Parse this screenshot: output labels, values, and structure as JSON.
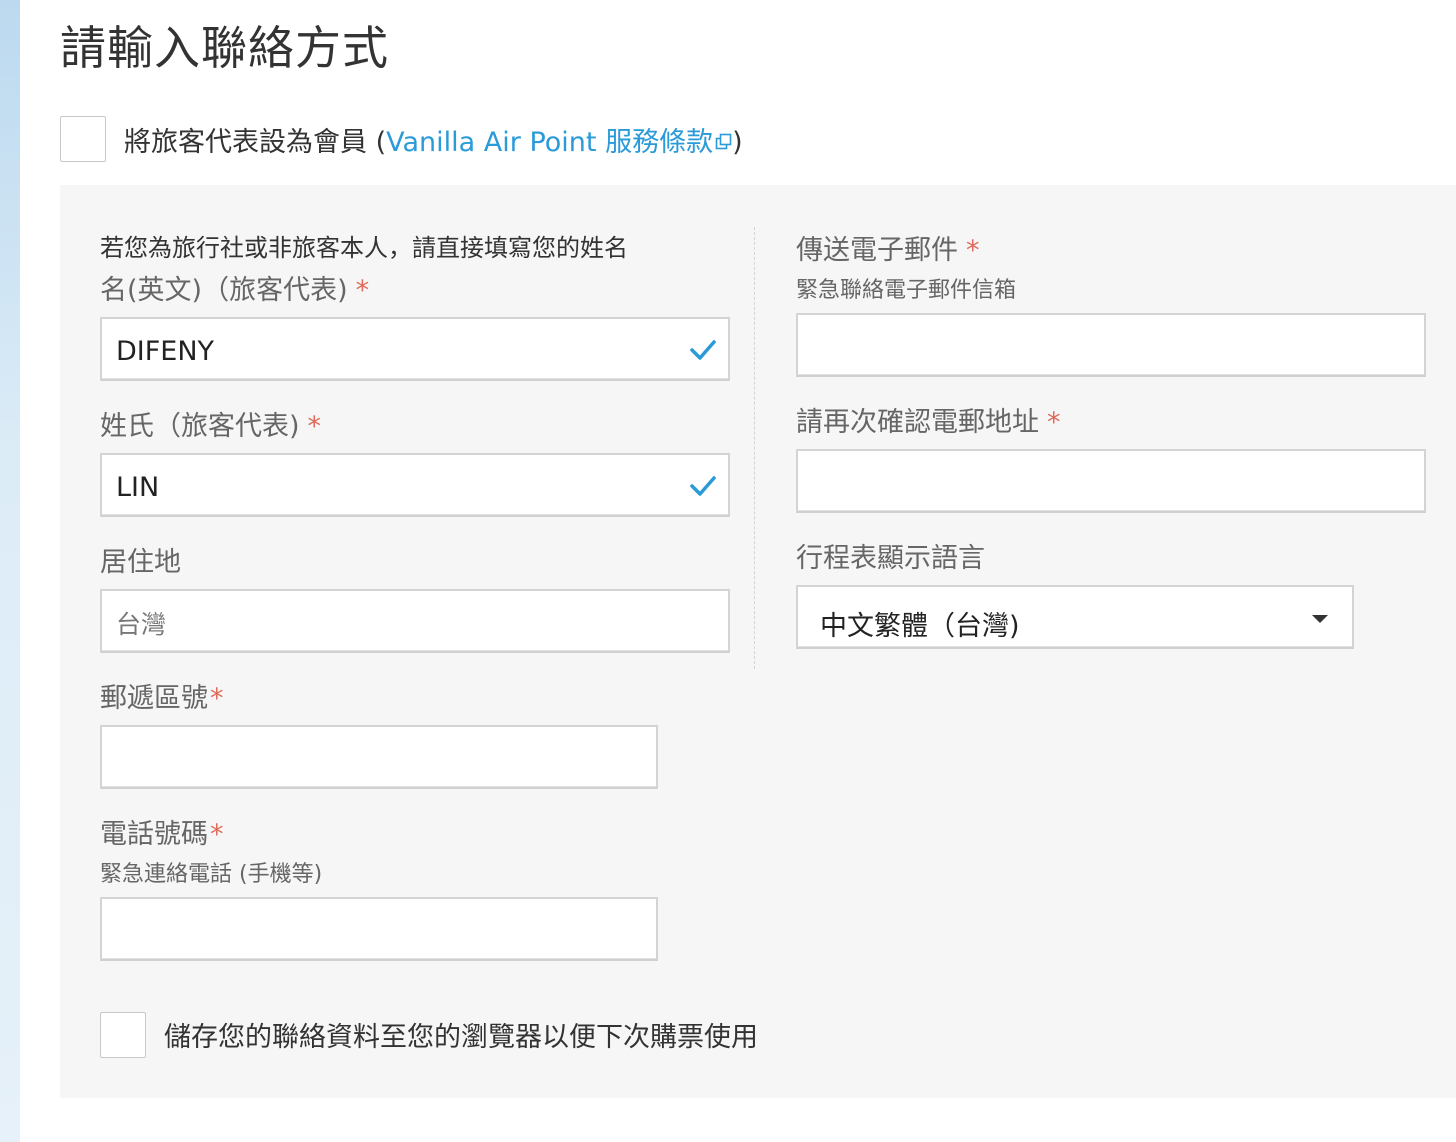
{
  "header": {
    "title": "請輸入聯絡方式"
  },
  "member": {
    "prefix": "將旅客代表設為會員 (",
    "link_text": "Vanilla Air Point 服務條款",
    "suffix": ")"
  },
  "left": {
    "note": "若您為旅行社或非旅客本人，請直接填寫您的姓名",
    "first_name": {
      "label": "名(英文)（旅客代表)",
      "required": "*",
      "value": "DIFENY"
    },
    "last_name": {
      "label": "姓氏（旅客代表)",
      "required": "*",
      "value": "LIN"
    },
    "residence": {
      "label": "居住地",
      "value": "台灣"
    },
    "postal": {
      "label": "郵遞區號",
      "required": "*",
      "value": ""
    },
    "phone": {
      "label": "電話號碼",
      "required": "*",
      "sublabel": "緊急連絡電話 (手機等)",
      "value": ""
    }
  },
  "right": {
    "email": {
      "label": "傳送電子郵件",
      "required": "*",
      "sublabel": "緊急聯絡電子郵件信箱",
      "value": ""
    },
    "email_confirm": {
      "label": "請再次確認電郵地址",
      "required": "*",
      "value": ""
    },
    "language": {
      "label": "行程表顯示語言",
      "value": "中文繁體（台灣)"
    }
  },
  "save": {
    "label": "儲存您的聯絡資料至您的瀏覽器以便下次購票使用"
  },
  "colors": {
    "accent": "#2a9ad8",
    "required": "#e06a5a",
    "panel_bg": "#f6f6f6"
  }
}
